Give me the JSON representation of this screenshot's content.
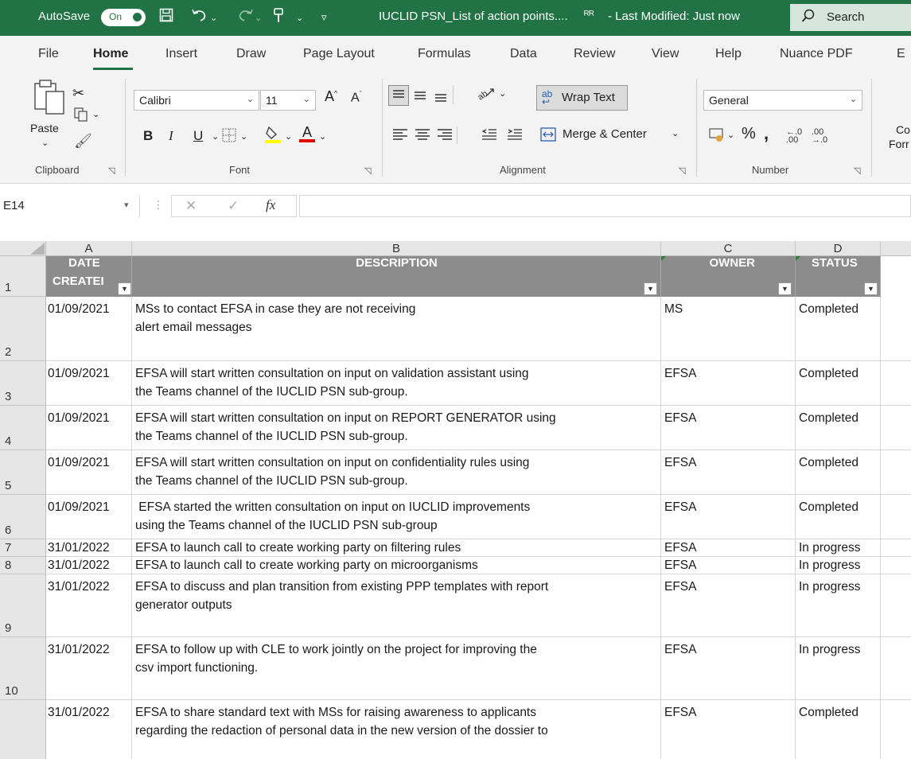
{
  "titlebar": {
    "autosave_label": "AutoSave",
    "autosave_state": "On",
    "filename": "IUCLID PSN_List of action points....",
    "modified": "- Last Modified: Just now",
    "search_label": "Search"
  },
  "tabs": [
    "File",
    "Home",
    "Insert",
    "Draw",
    "Page Layout",
    "Formulas",
    "Data",
    "Review",
    "View",
    "Help",
    "Nuance PDF",
    "E"
  ],
  "ribbon": {
    "paste_label": "Paste",
    "font_name": "Calibri",
    "font_size": "11",
    "wrap_text": "Wrap Text",
    "merge_center": "Merge & Center",
    "number_format": "General",
    "cond_label_1": "Co",
    "cond_label_2": "Forr",
    "groups": {
      "clipboard": "Clipboard",
      "font": "Font",
      "alignment": "Alignment",
      "number": "Number"
    }
  },
  "formula_bar": {
    "name_box": "E14",
    "formula": ""
  },
  "sheet": {
    "columns": [
      "A",
      "B",
      "C",
      "D"
    ],
    "headers": {
      "date_line1": "DATE",
      "date_line2": "CREATEI",
      "description": "DESCRIPTION",
      "owner": "OWNER",
      "status": "STATUS"
    },
    "rows": [
      {
        "num": "1"
      },
      {
        "num": "2",
        "date": "01/09/2021",
        "desc1": "MSs to contact EFSA in case they are not receiving",
        "desc2": "alert email messages",
        "owner": "MS",
        "status": "Completed"
      },
      {
        "num": "3",
        "date": "01/09/2021",
        "desc1": "EFSA will start written consultation on input on validation assistant using",
        "desc2": "the Teams channel of the IUCLID PSN sub-group.",
        "owner": "EFSA",
        "status": "Completed"
      },
      {
        "num": "4",
        "date": "01/09/2021",
        "desc1": "EFSA will start written consultation on input on REPORT GENERATOR using",
        "desc2": "the Teams channel of the IUCLID PSN sub-group.",
        "owner": "EFSA",
        "status": "Completed"
      },
      {
        "num": "5",
        "date": "01/09/2021",
        "desc1": "EFSA will start written consultation on input on confidentiality rules using",
        "desc2": "the Teams channel of the IUCLID PSN sub-group.",
        "owner": "EFSA",
        "status": "Completed"
      },
      {
        "num": "6",
        "date": "01/09/2021",
        "desc1": " EFSA started the written consultation on input on IUCLID improvements",
        "desc2": "using the Teams channel of the IUCLID PSN sub-group",
        "owner": "EFSA",
        "status": "Completed"
      },
      {
        "num": "7",
        "date": "31/01/2022",
        "desc1": "EFSA to launch call to create working party on filtering rules",
        "desc2": "",
        "owner": "EFSA",
        "status": "In progress"
      },
      {
        "num": "8",
        "date": "31/01/2022",
        "desc1": "EFSA to launch call to create working party on microorganisms",
        "desc2": "",
        "owner": "EFSA",
        "status": "In progress"
      },
      {
        "num": "9",
        "date": "31/01/2022",
        "desc1": "EFSA to discuss and plan transition from existing PPP templates with report",
        "desc2": "generator outputs",
        "owner": "EFSA",
        "status": "In progress"
      },
      {
        "num": "10",
        "date": "31/01/2022",
        "desc1": "EFSA to follow up with CLE to work jointly on the project for improving the",
        "desc2": "csv import functioning.",
        "owner": "EFSA",
        "status": "In progress"
      },
      {
        "num": "",
        "date": "31/01/2022",
        "desc1": "EFSA to share standard text with MSs for raising awareness to applicants",
        "desc2": "regarding the redaction of personal data in the new version of the dossier to",
        "owner": "EFSA",
        "status": "Completed"
      }
    ]
  }
}
